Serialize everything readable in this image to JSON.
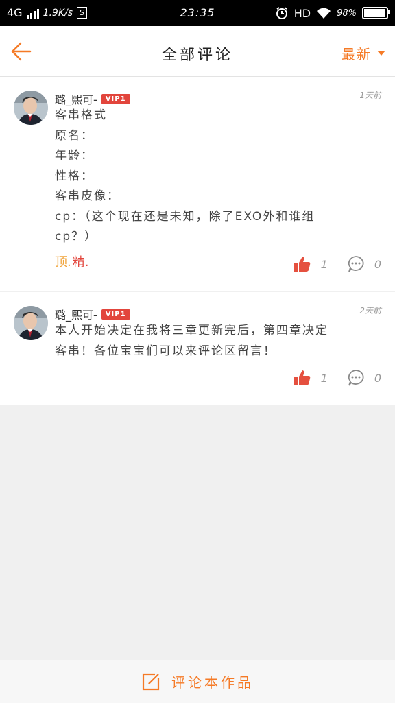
{
  "status_bar": {
    "network": "4G",
    "speed": "1.9K/s",
    "s_icon_label": "S",
    "time": "23:35",
    "hd": "HD",
    "battery_percent": "98%",
    "battery_level": 0.98
  },
  "header": {
    "title": "全部评论",
    "sort_label": "最新",
    "accent": "#f57a26"
  },
  "comments": [
    {
      "username": "璐_熙可-",
      "badge": "VIP1",
      "time": "1天前",
      "lines": [
        "客串格式",
        "原名：",
        "年龄：",
        "性格：",
        "客串皮像：",
        "cp：（这个现在还是未知，除了EXO外和谁组",
        "cp？）"
      ],
      "tag_top": "顶.",
      "tag_jing": "精.",
      "likes": "1",
      "replies": "0"
    },
    {
      "username": "璐_熙可-",
      "badge": "VIP1",
      "time": "2天前",
      "lines": [
        "本人开始决定在我将三章更新完后，第四章决定",
        "客串！各位宝宝们可以来评论区留言！"
      ],
      "likes": "1",
      "replies": "0"
    }
  ],
  "bottom_bar": {
    "label": "评论本作品"
  }
}
